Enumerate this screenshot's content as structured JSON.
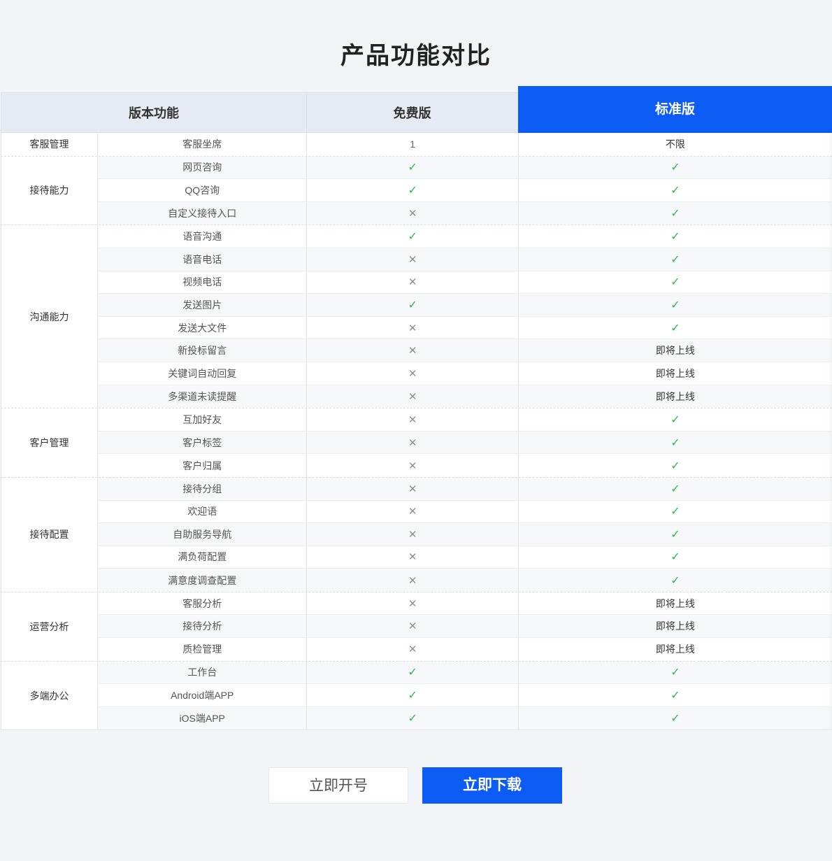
{
  "title": "产品功能对比",
  "header": {
    "feature": "版本功能",
    "free": "免费版",
    "standard": "标准版"
  },
  "groups": [
    {
      "name": "客服管理",
      "rows": [
        {
          "feature": "客服坐席",
          "free": "1",
          "standard": "不限"
        }
      ]
    },
    {
      "name": "接待能力",
      "rows": [
        {
          "feature": "网页咨询",
          "free": "check",
          "standard": "check"
        },
        {
          "feature": "QQ咨询",
          "free": "check",
          "standard": "check"
        },
        {
          "feature": "自定义接待入口",
          "free": "cross",
          "standard": "check"
        }
      ]
    },
    {
      "name": "沟通能力",
      "rows": [
        {
          "feature": "语音沟通",
          "free": "check",
          "standard": "check"
        },
        {
          "feature": "语音电话",
          "free": "cross",
          "standard": "check"
        },
        {
          "feature": "视频电话",
          "free": "cross",
          "standard": "check"
        },
        {
          "feature": "发送图片",
          "free": "check",
          "standard": "check"
        },
        {
          "feature": "发送大文件",
          "free": "cross",
          "standard": "check"
        },
        {
          "feature": "新投标留言",
          "free": "cross",
          "standard": "即将上线"
        },
        {
          "feature": "关键词自动回复",
          "free": "cross",
          "standard": "即将上线"
        },
        {
          "feature": "多渠道未读提醒",
          "free": "cross",
          "standard": "即将上线"
        }
      ]
    },
    {
      "name": "客户管理",
      "rows": [
        {
          "feature": "互加好友",
          "free": "cross",
          "standard": "check"
        },
        {
          "feature": "客户标签",
          "free": "cross",
          "standard": "check"
        },
        {
          "feature": "客户归属",
          "free": "cross",
          "standard": "check"
        }
      ]
    },
    {
      "name": "接待配置",
      "rows": [
        {
          "feature": "接待分组",
          "free": "cross",
          "standard": "check"
        },
        {
          "feature": "欢迎语",
          "free": "cross",
          "standard": "check"
        },
        {
          "feature": "自助服务导航",
          "free": "cross",
          "standard": "check"
        },
        {
          "feature": "满负荷配置",
          "free": "cross",
          "standard": "check"
        },
        {
          "feature": "满意度调查配置",
          "free": "cross",
          "standard": "check"
        }
      ]
    },
    {
      "name": "运营分析",
      "rows": [
        {
          "feature": "客服分析",
          "free": "cross",
          "standard": "即将上线"
        },
        {
          "feature": "接待分析",
          "free": "cross",
          "standard": "即将上线"
        },
        {
          "feature": "质检管理",
          "free": "cross",
          "standard": "即将上线"
        }
      ]
    },
    {
      "name": "多端办公",
      "rows": [
        {
          "feature": "工作台",
          "free": "check",
          "standard": "check"
        },
        {
          "feature": "Android端APP",
          "free": "check",
          "standard": "check"
        },
        {
          "feature": "iOS端APP",
          "free": "check",
          "standard": "check"
        }
      ]
    }
  ],
  "buttons": {
    "open": "立即开号",
    "download": "立即下载"
  },
  "colors": {
    "accent": "#0c5bf4",
    "check": "#2db94d",
    "background": "#f2f5f8"
  }
}
